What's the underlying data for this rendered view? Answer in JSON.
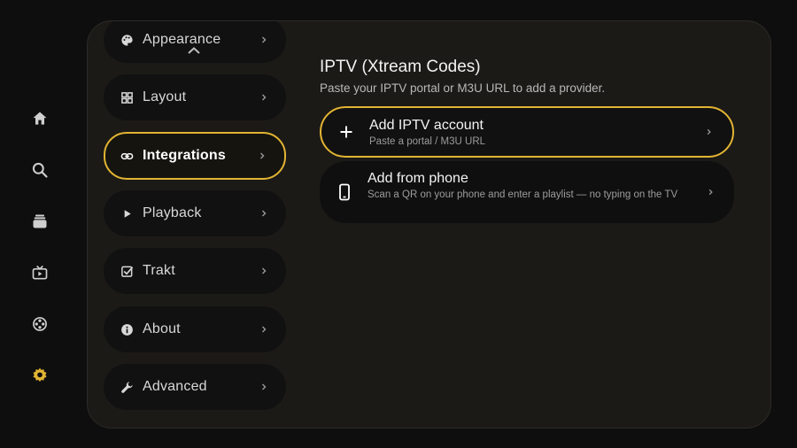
{
  "rail": {
    "items": [
      {
        "name": "home-icon"
      },
      {
        "name": "search-icon"
      },
      {
        "name": "library-icon"
      },
      {
        "name": "live-tv-icon"
      },
      {
        "name": "reel-icon"
      },
      {
        "name": "settings-icon"
      }
    ],
    "active_color": "#e2b432"
  },
  "sidebar": {
    "items": [
      {
        "label": "Appearance",
        "icon": "palette-icon"
      },
      {
        "label": "Layout",
        "icon": "grid-icon"
      },
      {
        "label": "Integrations",
        "icon": "link-icon",
        "selected": true
      },
      {
        "label": "Playback",
        "icon": "play-icon"
      },
      {
        "label": "Trakt",
        "icon": "checkbox-icon"
      },
      {
        "label": "About",
        "icon": "info-icon"
      },
      {
        "label": "Advanced",
        "icon": "wrench-icon"
      }
    ]
  },
  "content": {
    "title": "IPTV (Xtream Codes)",
    "subtitle": "Paste your IPTV portal or M3U URL to add a provider.",
    "options": [
      {
        "title": "Add IPTV account",
        "desc": "Paste a portal / M3U URL",
        "icon": "plus-icon"
      },
      {
        "title": "Add from phone",
        "desc": "Scan a QR on your phone and enter a playlist — no typing on the TV",
        "icon": "phone-icon"
      }
    ]
  },
  "accent": "#e2b432"
}
